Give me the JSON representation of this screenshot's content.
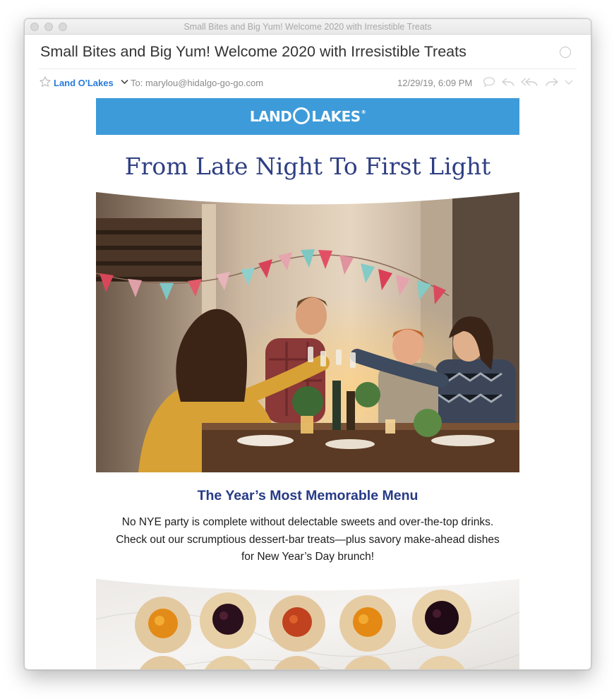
{
  "window": {
    "title": "Small Bites and Big Yum! Welcome 2020 with Irresistible Treats"
  },
  "message": {
    "subject": "Small Bites and Big Yum! Welcome 2020 with Irresistible Treats",
    "sender": "Land O'Lakes",
    "to_label": "To:  marylou@hidalgo-go-go.com",
    "date": "12/29/19, 6:09 PM",
    "icons": [
      "star-icon",
      "chevron-down-icon",
      "chat-bubble-icon",
      "reply-icon",
      "reply-all-icon",
      "forward-icon",
      "more-chevron-icon",
      "unread-circle-icon"
    ]
  },
  "email": {
    "banner": {
      "logo_left": "LAND",
      "logo_right": "LAKES",
      "logo_reg": "®",
      "color": "#3e9bd9"
    },
    "headline": "From Late Night To First Light",
    "hero_photo": "new-years-eve-dinner-toast",
    "section_title": "The Year’s Most Memorable Menu",
    "section_text": "No NYE party is complete without delectable sweets and over-the-top drinks. Check out our scrumptious dessert-bar treats—plus savory make-ahead dishes for New Year’s Day brunch!",
    "cookies_photo": "jam-thumbprint-cookies",
    "colors": {
      "headline": "#2f3f83",
      "section_title": "#263a86",
      "sender_link": "#2a7ad9"
    }
  }
}
